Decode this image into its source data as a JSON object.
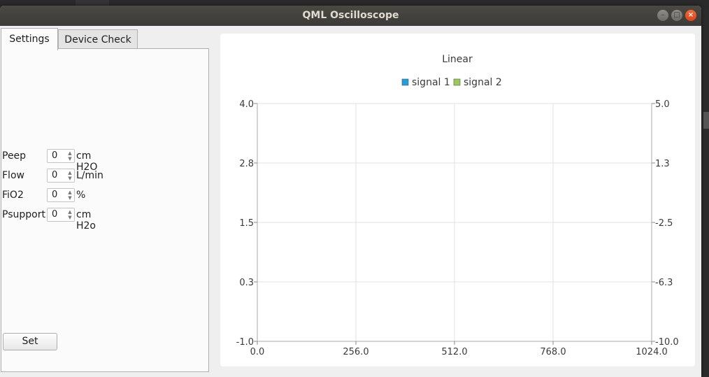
{
  "window": {
    "title": "QML Oscilloscope"
  },
  "tabs": [
    {
      "label": "Settings",
      "active": true
    },
    {
      "label": "Device Check",
      "active": false
    }
  ],
  "settings": {
    "rows": [
      {
        "label": "Peep",
        "value": "0",
        "unit": "cm H2O"
      },
      {
        "label": "Flow",
        "value": "0",
        "unit": "L/min"
      },
      {
        "label": "FiO2",
        "value": "0",
        "unit": "%"
      },
      {
        "label": "Psupport",
        "value": "0",
        "unit": "cm H2o"
      }
    ],
    "set_label": "Set"
  },
  "chart_data": {
    "type": "line",
    "title": "Linear",
    "legend_position": "top-center",
    "series": [
      {
        "name": "signal 1",
        "color": "#209fdf",
        "x": [],
        "y": []
      },
      {
        "name": "signal 2",
        "color": "#99ca53",
        "x": [],
        "y": []
      }
    ],
    "x_ticks": [
      "0.0",
      "256.0",
      "512.0",
      "768.0",
      "1024.0"
    ],
    "y_left_ticks": [
      "4.0",
      "2.8",
      "1.5",
      "0.3",
      "-1.0"
    ],
    "y_right_ticks": [
      "5.0",
      "1.3",
      "-2.5",
      "-6.3",
      "-10.0"
    ],
    "xlim": [
      0,
      1024
    ],
    "ylim_left": [
      -1,
      4
    ],
    "ylim_right": [
      -10,
      5
    ],
    "grid": true
  }
}
